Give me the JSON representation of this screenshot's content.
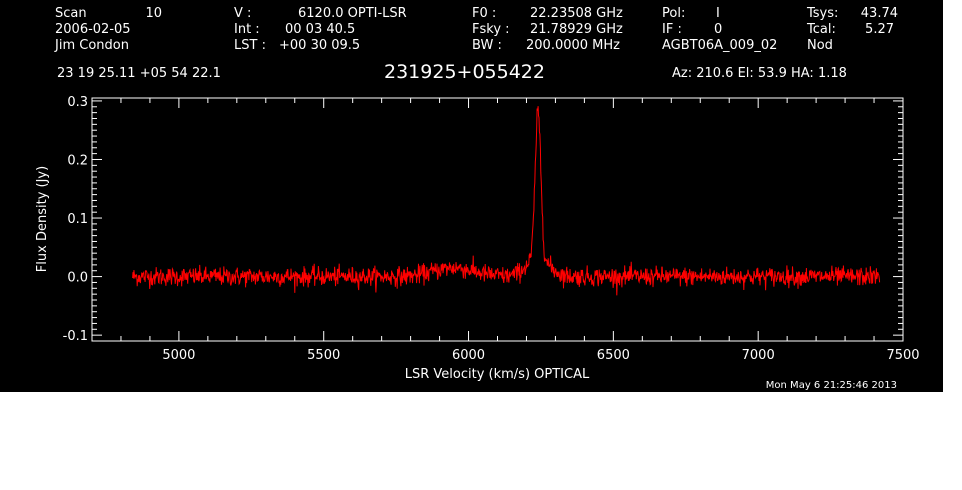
{
  "header": {
    "col1": [
      "Scan",
      "2006-02-05",
      "Jim Condon"
    ],
    "scan_number": "10",
    "col2_labels": [
      "V  :",
      "Int  :",
      "LST :"
    ],
    "col2_values": [
      "6120.0 OPTI-LSR",
      "00 03 40.5",
      "+00 30 09.5"
    ],
    "col3_labels": [
      "F0  :",
      "Fsky :",
      "BW  :"
    ],
    "col3_values": [
      "22.23508 GHz",
      "21.78929 GHz",
      "200.0000 MHz"
    ],
    "col4": [
      "Pol:",
      "IF :",
      "AGBT06A_009_02"
    ],
    "col4_values": [
      "I",
      "0",
      ""
    ],
    "col5_labels": [
      "Tsys:",
      "Tcal:",
      "Nod"
    ],
    "col5_values": [
      "43.74",
      "5.27",
      ""
    ],
    "coords": "23 19 25.11  +05 54 22.1",
    "source": "231925+055422",
    "pointing": "Az: 210.6   El:  53.9   HA:  1.18",
    "timestamp": "Mon May  6 21:25:46 2013"
  },
  "chart_data": {
    "type": "line",
    "title": "231925+055422",
    "xlabel": "LSR Velocity (km/s) OPTICAL",
    "ylabel": "Flux Density (Jy)",
    "xlim": [
      4700,
      7500
    ],
    "ylim": [
      -0.11,
      0.305
    ],
    "xticks": [
      5000,
      5500,
      6000,
      6500,
      7000,
      7500
    ],
    "yticks": [
      -0.1,
      0.0,
      0.1,
      0.2,
      0.3
    ],
    "ytick_labels": [
      "-0.1",
      "0.0",
      "0.1",
      "0.2",
      "0.3"
    ],
    "grid": false,
    "series": [
      {
        "color": "#ff0000",
        "x_range": [
          4840,
          7420
        ],
        "noise_rms_jy": 0.008,
        "features": [
          {
            "type": "broad_bump",
            "center_kms": 5950,
            "width_kms": 70,
            "peak_jy": 0.015
          },
          {
            "type": "emission_line",
            "center_kms": 6240,
            "width_kms": 10,
            "peak_jy": 0.25
          },
          {
            "type": "emission_wing",
            "center_kms": 6240,
            "width_kms": 40,
            "peak_jy": 0.03
          }
        ]
      }
    ]
  },
  "colors": {
    "background": "#000000",
    "axes": "#ffffff",
    "trace": "#ff0000"
  }
}
